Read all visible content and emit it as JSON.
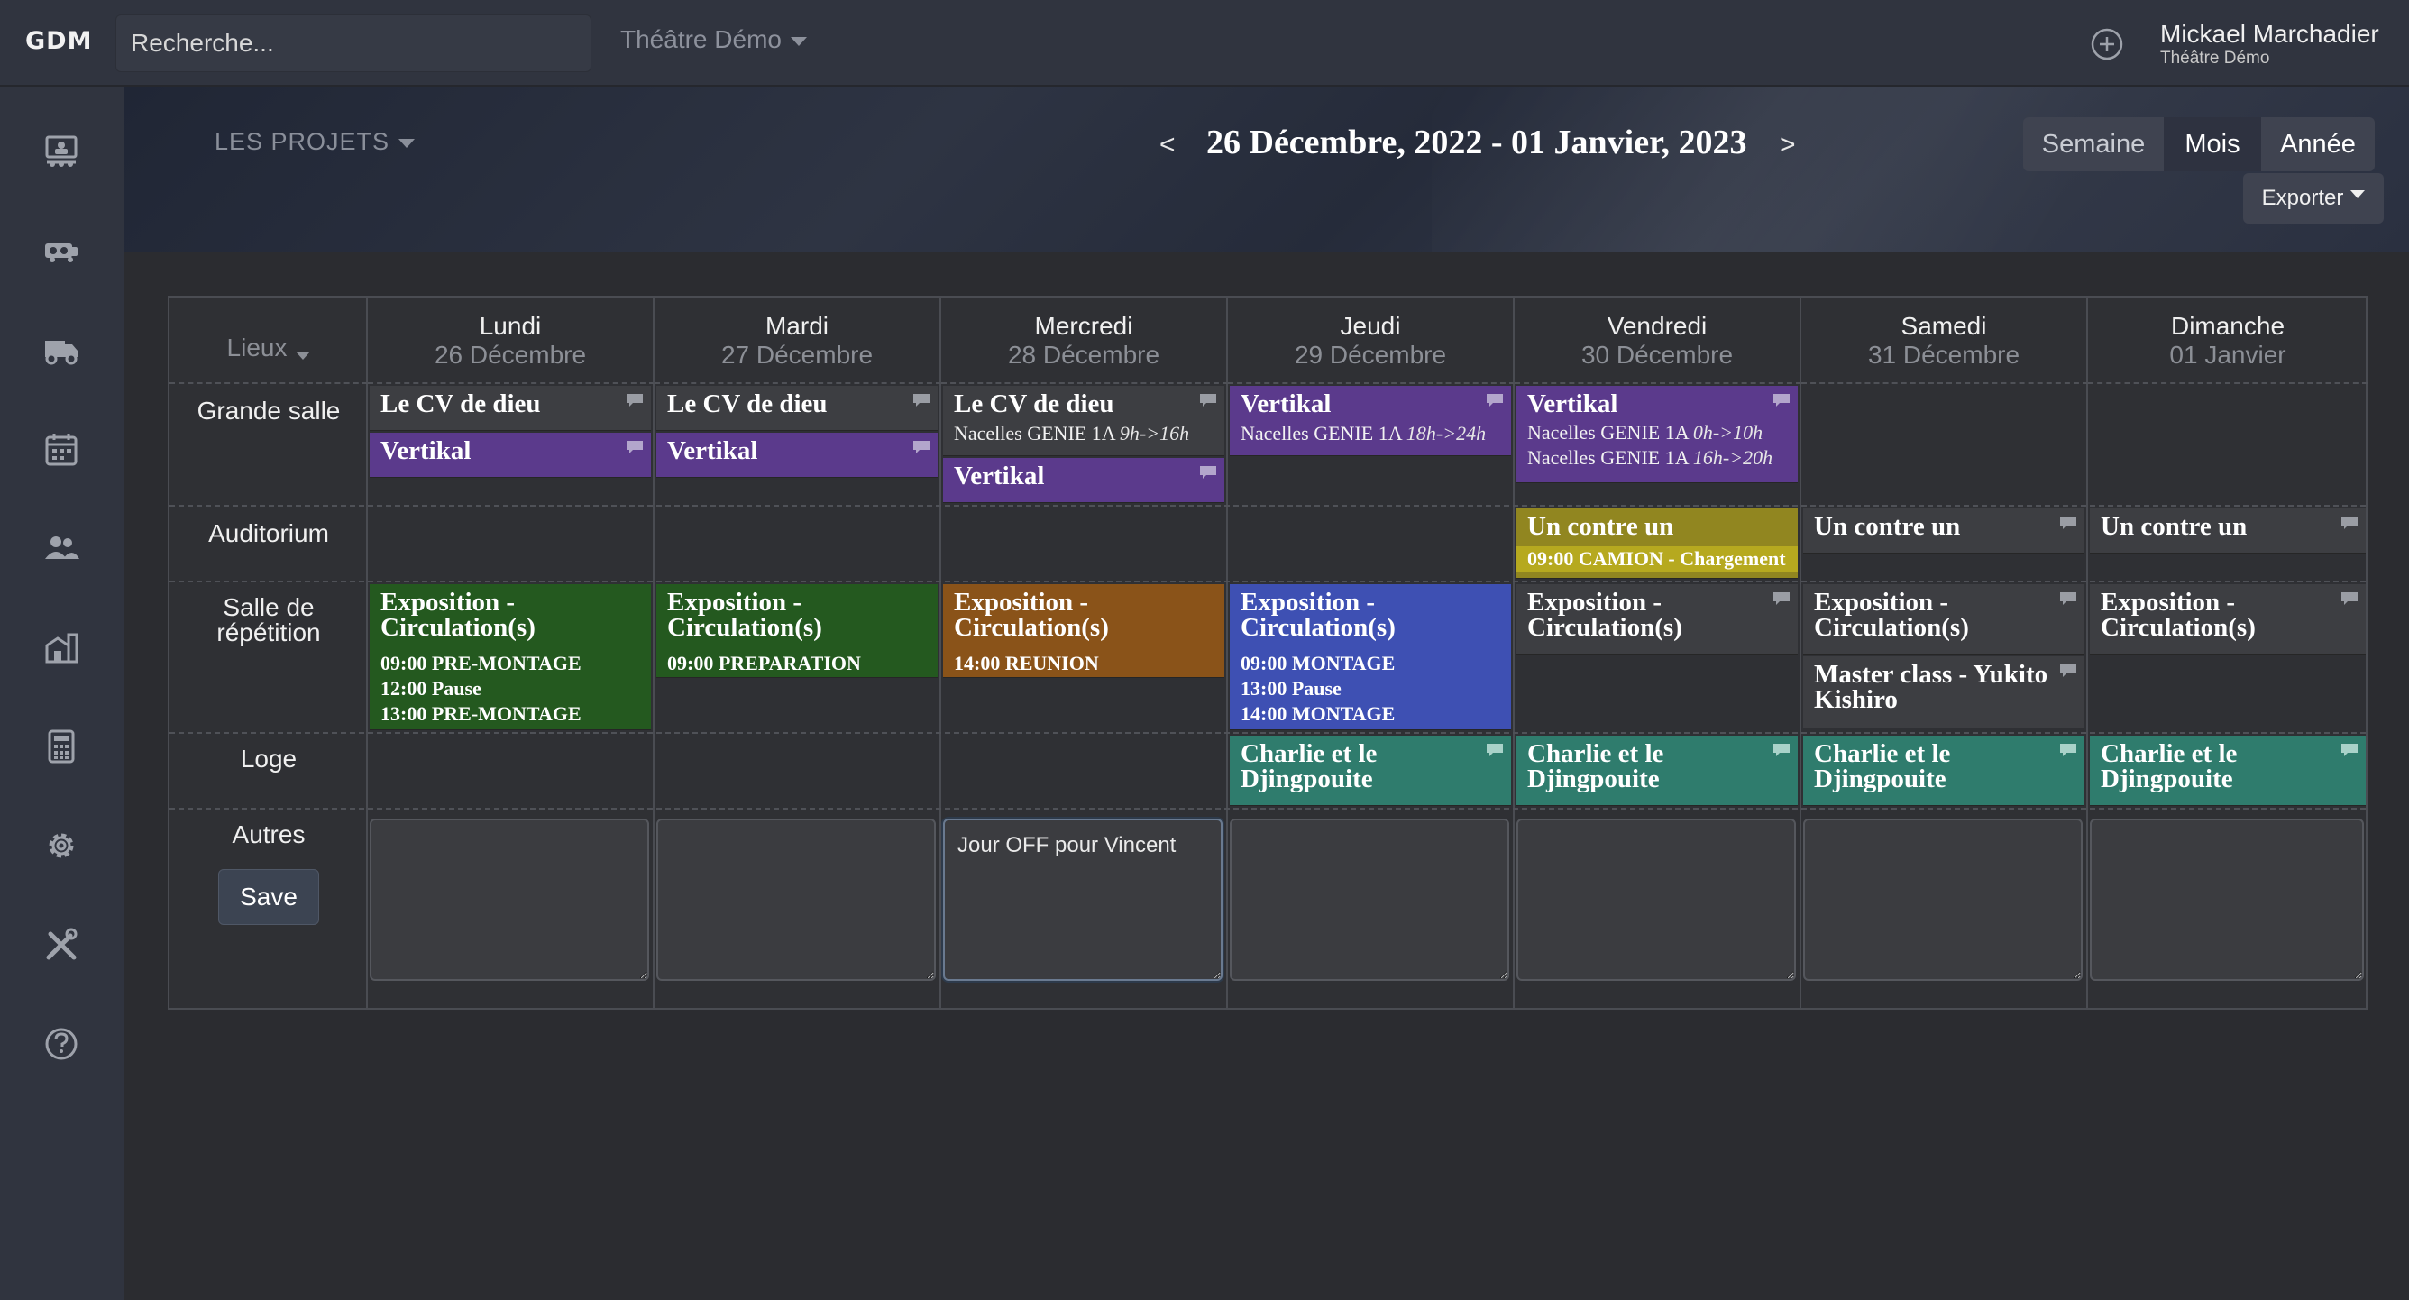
{
  "topbar": {
    "logo": "GDM",
    "search_placeholder": "Recherche...",
    "theatre_dropdown": "Théâtre Démo",
    "user_name": "Mickael Marchadier",
    "user_org": "Théâtre Démo"
  },
  "sidebar": {
    "items": [
      "presentation-icon",
      "truck-icon",
      "van-icon",
      "calendar-icon",
      "people-icon",
      "buildings-icon",
      "calculator-icon",
      "gear-icon",
      "tools-icon",
      "help-icon"
    ]
  },
  "banner": {
    "projects_dropdown": "LES PROJETS",
    "prev": "<",
    "next": ">",
    "date_range": "26 Décembre, 2022 - 01 Janvier, 2023",
    "views": {
      "semaine": "Semaine",
      "mois": "Mois",
      "annee": "Année"
    },
    "export": "Exporter"
  },
  "calendar": {
    "lieux_label": "Lieux",
    "days": [
      {
        "name": "Lundi",
        "date": "26 Décembre"
      },
      {
        "name": "Mardi",
        "date": "27 Décembre"
      },
      {
        "name": "Mercredi",
        "date": "28 Décembre"
      },
      {
        "name": "Jeudi",
        "date": "29 Décembre"
      },
      {
        "name": "Vendredi",
        "date": "30 Décembre"
      },
      {
        "name": "Samedi",
        "date": "31 Décembre"
      },
      {
        "name": "Dimanche",
        "date": "01 Janvier"
      }
    ],
    "rooms": {
      "grande_salle": "Grande salle",
      "auditorium": "Auditorium",
      "salle_repetition": "Salle de répétition",
      "loge": "Loge",
      "autres": "Autres"
    },
    "events": {
      "le_cv_de_dieu": "Le CV de dieu",
      "vertikal": "Vertikal",
      "nacelles": "Nacelles GENIE 1A",
      "wed_nacelles_time": "9h->16h",
      "thu_nacelles_time": "18h->24h",
      "fri_nacelles_time_1": "0h->10h",
      "fri_nacelles_time_2": "16h->20h",
      "un_contre_un": "Un contre un",
      "camion": "09:00 CAMION - Chargement",
      "exposition": "Exposition - Circulation(s)",
      "mon_detail": [
        "09:00 PRE-MONTAGE",
        "12:00 Pause",
        "13:00 PRE-MONTAGE"
      ],
      "tue_detail": [
        "09:00 PREPARATION"
      ],
      "wed_detail": [
        "14:00 REUNION"
      ],
      "thu_detail": [
        "09:00 MONTAGE",
        "13:00 Pause",
        "14:00 MONTAGE"
      ],
      "master_class": "Master class - Yukito Kishiro",
      "charlie": "Charlie et le Djingpouite"
    },
    "notes": [
      "",
      "",
      "Jour OFF pour Vincent",
      "",
      "",
      "",
      ""
    ],
    "save_label": "Save"
  },
  "colors": {
    "purple": "#5b3a8c",
    "green": "#24591f",
    "orange": "#8a5319",
    "blue": "#3e50b3",
    "olive": "#918620",
    "teal": "#2f7c6d",
    "gray": "#3d3e42"
  }
}
